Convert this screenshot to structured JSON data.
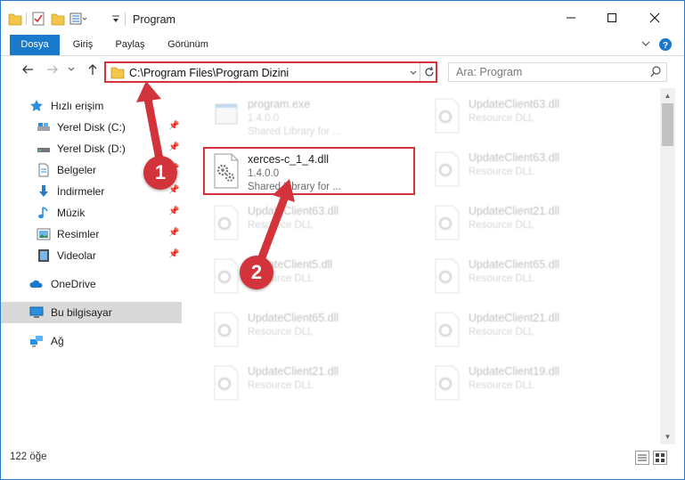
{
  "window": {
    "title": "Program"
  },
  "ribbon": {
    "tabs": [
      {
        "label": "Dosya"
      },
      {
        "label": "Giriş"
      },
      {
        "label": "Paylaş"
      },
      {
        "label": "Görünüm"
      }
    ]
  },
  "address": {
    "path": "C:\\Program Files\\Program Dizini"
  },
  "search": {
    "placeholder": "Ara: Program"
  },
  "nav": {
    "quick_access": "Hızlı erişim",
    "items": [
      {
        "label": "Yerel Disk (C:)",
        "icon": "drive-icon"
      },
      {
        "label": "Yerel Disk (D:)",
        "icon": "drive-icon"
      },
      {
        "label": "Belgeler",
        "icon": "documents-icon"
      },
      {
        "label": "İndirmeler",
        "icon": "download-icon"
      },
      {
        "label": "Müzik",
        "icon": "music-icon"
      },
      {
        "label": "Resimler",
        "icon": "pictures-icon"
      },
      {
        "label": "Videolar",
        "icon": "video-icon"
      }
    ],
    "onedrive": "OneDrive",
    "this_pc": "Bu bilgisayar",
    "network": "Ağ"
  },
  "files": {
    "left": [
      {
        "name": "program.exe",
        "line2": "1.4.0.0",
        "line3": "Shared Library for ..."
      },
      {
        "name": "xerces-c_1_4.dll",
        "line2": "1.4.0.0",
        "line3": "Shared Library for ..."
      },
      {
        "name": "UpdateClient63.dll",
        "line2": "Resource DLL",
        "line3": ""
      },
      {
        "name": "UpdateClient5.dll",
        "line2": "Resource DLL",
        "line3": ""
      },
      {
        "name": "UpdateClient65.dll",
        "line2": "Resource DLL",
        "line3": ""
      },
      {
        "name": "UpdateClient21.dll",
        "line2": "Resource DLL",
        "line3": ""
      }
    ],
    "right": [
      {
        "name": "UpdateClient63.dll",
        "line2": "Resource DLL"
      },
      {
        "name": "UpdateClient63.dll",
        "line2": "Resource DLL"
      },
      {
        "name": "UpdateClient21.dll",
        "line2": "Resource DLL"
      },
      {
        "name": "UpdateClient65.dll",
        "line2": "Resource DLL"
      },
      {
        "name": "UpdateClient21.dll",
        "line2": "Resource DLL"
      },
      {
        "name": "UpdateClient19.dll",
        "line2": "Resource DLL"
      }
    ]
  },
  "status": {
    "count": "122 öğe"
  },
  "annotations": {
    "step1": "1",
    "step2": "2"
  },
  "colors": {
    "accent": "#1979ca",
    "highlight": "#d3343b"
  }
}
